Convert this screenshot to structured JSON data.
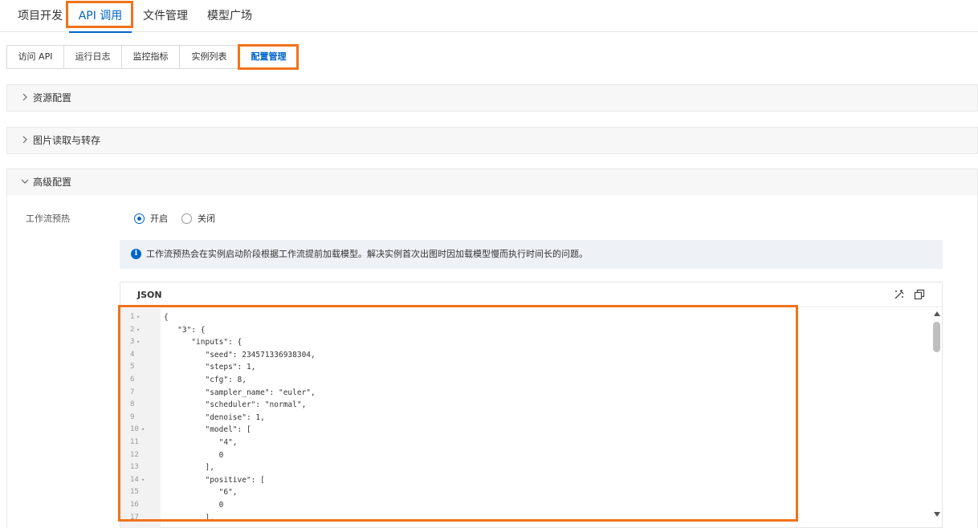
{
  "top_tabs": [
    {
      "label": "项目开发"
    },
    {
      "label": "API 调用"
    },
    {
      "label": "文件管理"
    },
    {
      "label": "模型广场"
    }
  ],
  "sub_tabs": [
    {
      "label": "访问 API"
    },
    {
      "label": "运行日志"
    },
    {
      "label": "监控指标"
    },
    {
      "label": "实例列表"
    },
    {
      "label": "配置管理"
    }
  ],
  "panels": [
    {
      "title": "资源配置",
      "expanded": false
    },
    {
      "title": "图片读取与转存",
      "expanded": false
    },
    {
      "title": "高级配置",
      "expanded": true
    }
  ],
  "advanced": {
    "workflow_preheat_label": "工作流预热",
    "radio_on_label": "开启",
    "radio_off_label": "关闭",
    "selected": "开启",
    "info_icon": "info-icon",
    "info_text": "工作流预热会在实例启动阶段根据工作流提前加载模型。解决实例首次出图时因加载模型慢而执行时间长的问题。"
  },
  "editor": {
    "title": "JSON",
    "tools": [
      "format-icon",
      "fullscreen-icon"
    ],
    "lines": [
      {
        "n": "1",
        "fold": true,
        "text": "{"
      },
      {
        "n": "2",
        "fold": true,
        "text": "   \"3\": {"
      },
      {
        "n": "3",
        "fold": true,
        "text": "      \"inputs\": {"
      },
      {
        "n": "4",
        "fold": false,
        "text": "         \"seed\": 234571336938304,"
      },
      {
        "n": "5",
        "fold": false,
        "text": "         \"steps\": 1,"
      },
      {
        "n": "6",
        "fold": false,
        "text": "         \"cfg\": 8,"
      },
      {
        "n": "7",
        "fold": false,
        "text": "         \"sampler_name\": \"euler\","
      },
      {
        "n": "8",
        "fold": false,
        "text": "         \"scheduler\": \"normal\","
      },
      {
        "n": "9",
        "fold": false,
        "text": "         \"denoise\": 1,"
      },
      {
        "n": "10",
        "fold": true,
        "text": "         \"model\": ["
      },
      {
        "n": "11",
        "fold": false,
        "text": "            \"4\","
      },
      {
        "n": "12",
        "fold": false,
        "text": "            0"
      },
      {
        "n": "13",
        "fold": false,
        "text": "         ],"
      },
      {
        "n": "14",
        "fold": true,
        "text": "         \"positive\": ["
      },
      {
        "n": "15",
        "fold": false,
        "text": "            \"6\","
      },
      {
        "n": "16",
        "fold": false,
        "text": "            0"
      },
      {
        "n": "17",
        "fold": false,
        "text": "         ],"
      }
    ]
  },
  "colors": {
    "accent": "#0064c8",
    "highlight": "#f0731b",
    "json_token": "#7a3e9d"
  }
}
